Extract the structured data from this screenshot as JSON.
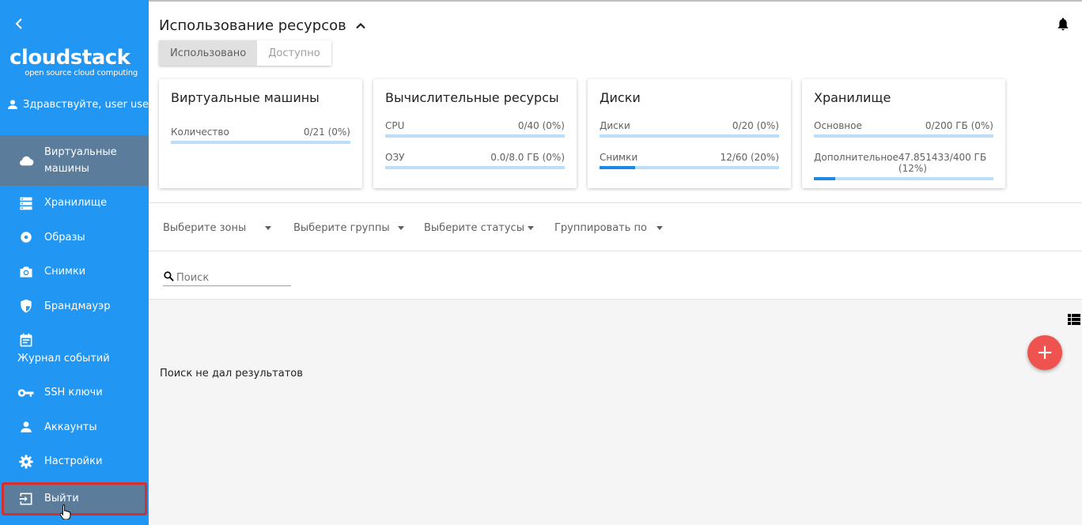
{
  "sidebar": {
    "logo_main": "cloudstack",
    "logo_sub": "open source cloud computing",
    "greeting": "Здравствуйте, user user",
    "items": [
      {
        "label": "Виртуальные машины",
        "icon": "cloud-icon"
      },
      {
        "label": "Хранилище",
        "icon": "storage-icon"
      },
      {
        "label": "Образы",
        "icon": "disc-icon"
      },
      {
        "label": "Снимки",
        "icon": "camera-icon"
      },
      {
        "label": "Брандмауэр",
        "icon": "shield-icon"
      },
      {
        "label": "Журнал событий",
        "icon": "calendar-icon"
      },
      {
        "label": "SSH ключи",
        "icon": "key-icon"
      },
      {
        "label": "Аккаунты",
        "icon": "person-icon"
      },
      {
        "label": "Настройки",
        "icon": "gear-icon"
      },
      {
        "label": "Выйти",
        "icon": "logout-icon"
      }
    ]
  },
  "resources": {
    "title": "Использование ресурсов",
    "toggle_used": "Использовано",
    "toggle_available": "Доступно",
    "cards": [
      {
        "title": "Виртуальные машины",
        "rows": [
          {
            "label": "Количество",
            "value": "0/21 (0%)",
            "fraction": 0
          }
        ]
      },
      {
        "title": "Вычислительные ресурсы",
        "rows": [
          {
            "label": "CPU",
            "value": "0/40 (0%)",
            "fraction": 0
          },
          {
            "label": "ОЗУ",
            "value": "0.0/8.0 ГБ (0%)",
            "fraction": 0
          }
        ]
      },
      {
        "title": "Диски",
        "rows": [
          {
            "label": "Диски",
            "value": "0/20 (0%)",
            "fraction": 0
          },
          {
            "label": "Снимки",
            "value": "12/60 (20%)",
            "fraction": 0.2
          }
        ]
      },
      {
        "title": "Хранилище",
        "rows": [
          {
            "label": "Основное",
            "value": "0/200 ГБ (0%)",
            "fraction": 0
          },
          {
            "label": "Дополнительное",
            "value": "47.851433/400 ГБ (12%)",
            "fraction": 0.12
          }
        ]
      }
    ]
  },
  "filters": {
    "zones": "Выберите зоны",
    "groups": "Выберите группы",
    "statuses": "Выберите статусы",
    "group_by": "Группировать по"
  },
  "search": {
    "placeholder": "Поиск",
    "value": ""
  },
  "results": {
    "empty_text": "Поиск не дал результатов",
    "fab_label": "+"
  },
  "colors": {
    "sidebar": "#2196f3",
    "active": "#5b7d9b",
    "accent": "#1e88e5",
    "fab": "#ef5350",
    "highlight": "#d32f2f"
  }
}
